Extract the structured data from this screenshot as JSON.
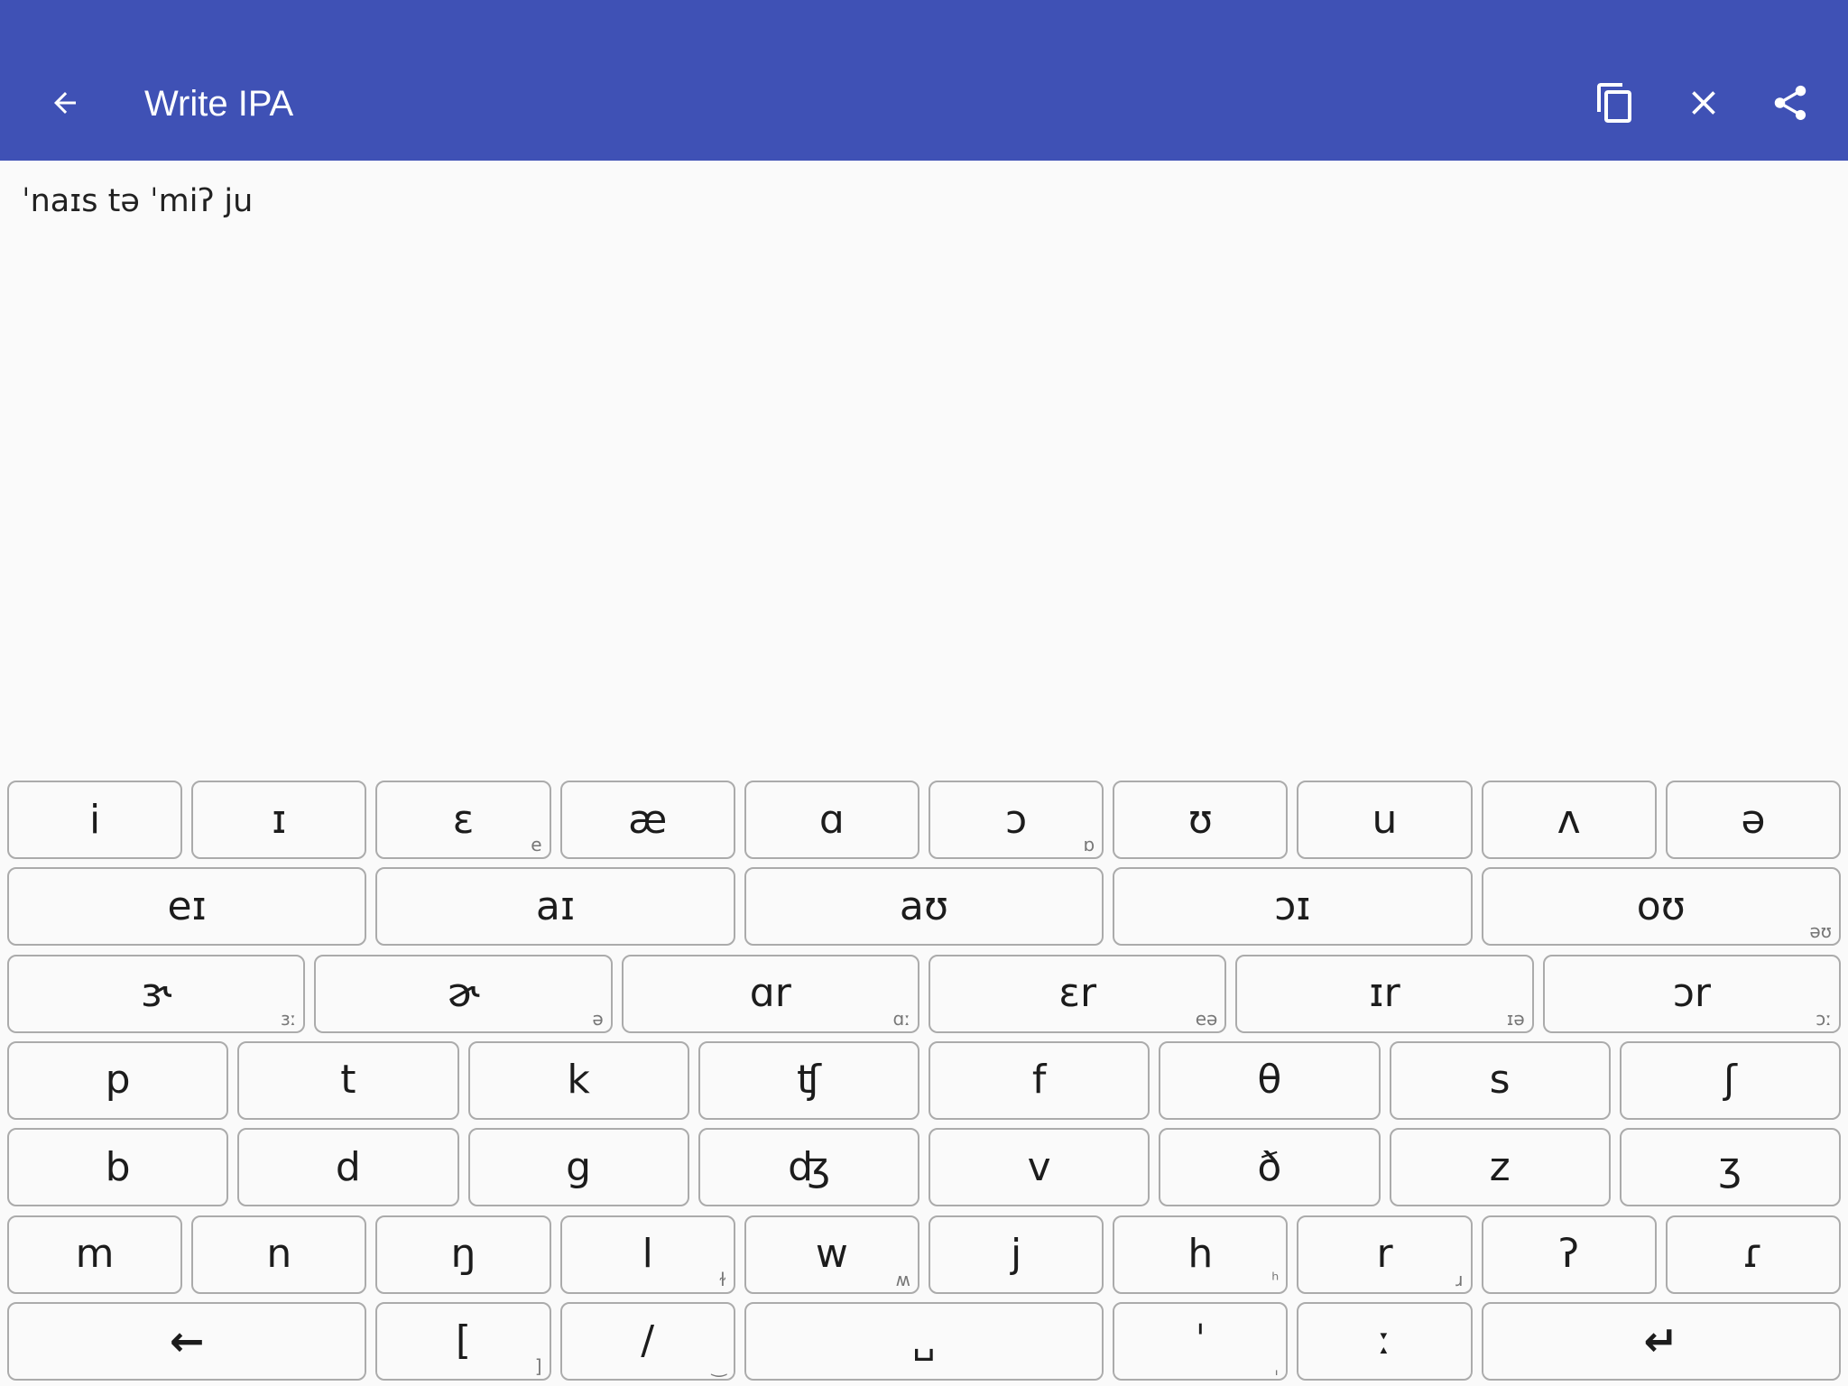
{
  "app_bar": {
    "title": "Write IPA",
    "back_icon": "arrow-left-icon",
    "actions": [
      {
        "name": "copy",
        "icon": "copy-icon"
      },
      {
        "name": "clear",
        "icon": "close-icon"
      },
      {
        "name": "share",
        "icon": "share-icon"
      }
    ],
    "color": "#3f51b5"
  },
  "editor": {
    "value": "ˈnaɪs tə ˈmiʔ ju"
  },
  "keyboard": {
    "rows": [
      [
        {
          "label": "i",
          "sub": ""
        },
        {
          "label": "ɪ",
          "sub": ""
        },
        {
          "label": "ɛ",
          "sub": "e"
        },
        {
          "label": "æ",
          "sub": ""
        },
        {
          "label": "ɑ",
          "sub": ""
        },
        {
          "label": "ɔ",
          "sub": "ɒ"
        },
        {
          "label": "ʊ",
          "sub": ""
        },
        {
          "label": "u",
          "sub": ""
        },
        {
          "label": "ʌ",
          "sub": ""
        },
        {
          "label": "ə",
          "sub": ""
        }
      ],
      [
        {
          "label": "eɪ",
          "sub": ""
        },
        {
          "label": "aɪ",
          "sub": ""
        },
        {
          "label": "aʊ",
          "sub": ""
        },
        {
          "label": "ɔɪ",
          "sub": ""
        },
        {
          "label": "oʊ",
          "sub": "əʊ"
        }
      ],
      [
        {
          "label": "ɝ",
          "sub": "ɜː"
        },
        {
          "label": "ɚ",
          "sub": "ə"
        },
        {
          "label": "ɑr",
          "sub": "ɑː"
        },
        {
          "label": "ɛr",
          "sub": "eə"
        },
        {
          "label": "ɪr",
          "sub": "ɪə"
        },
        {
          "label": "ɔr",
          "sub": "ɔː"
        }
      ],
      [
        {
          "label": "p",
          "sub": ""
        },
        {
          "label": "t",
          "sub": ""
        },
        {
          "label": "k",
          "sub": ""
        },
        {
          "label": "ʧ",
          "sub": ""
        },
        {
          "label": "f",
          "sub": ""
        },
        {
          "label": "θ",
          "sub": ""
        },
        {
          "label": "s",
          "sub": ""
        },
        {
          "label": "ʃ",
          "sub": ""
        }
      ],
      [
        {
          "label": "b",
          "sub": ""
        },
        {
          "label": "d",
          "sub": ""
        },
        {
          "label": "g",
          "sub": ""
        },
        {
          "label": "ʤ",
          "sub": ""
        },
        {
          "label": "v",
          "sub": ""
        },
        {
          "label": "ð",
          "sub": ""
        },
        {
          "label": "z",
          "sub": ""
        },
        {
          "label": "ʒ",
          "sub": ""
        }
      ],
      [
        {
          "label": "m",
          "sub": ""
        },
        {
          "label": "n",
          "sub": ""
        },
        {
          "label": "ŋ",
          "sub": ""
        },
        {
          "label": "l",
          "sub": "ɫ"
        },
        {
          "label": "w",
          "sub": "ʍ"
        },
        {
          "label": "j",
          "sub": ""
        },
        {
          "label": "h",
          "sub": "ʰ"
        },
        {
          "label": "r",
          "sub": "ɹ"
        },
        {
          "label": "ʔ",
          "sub": ""
        },
        {
          "label": "ɾ",
          "sub": ""
        }
      ],
      [
        {
          "label": "←",
          "sub": "",
          "name": "backspace"
        },
        {
          "label": "[",
          "sub": "]",
          "name": "bracket"
        },
        {
          "label": "/",
          "sub": "‿",
          "name": "slash"
        },
        {
          "label": "␣",
          "sub": "",
          "name": "space"
        },
        {
          "label": "ˈ",
          "sub": "ˌ",
          "name": "stress"
        },
        {
          "label": "ː",
          "sub": "",
          "name": "length"
        },
        {
          "label": "↵",
          "sub": "",
          "name": "enter"
        }
      ]
    ]
  }
}
